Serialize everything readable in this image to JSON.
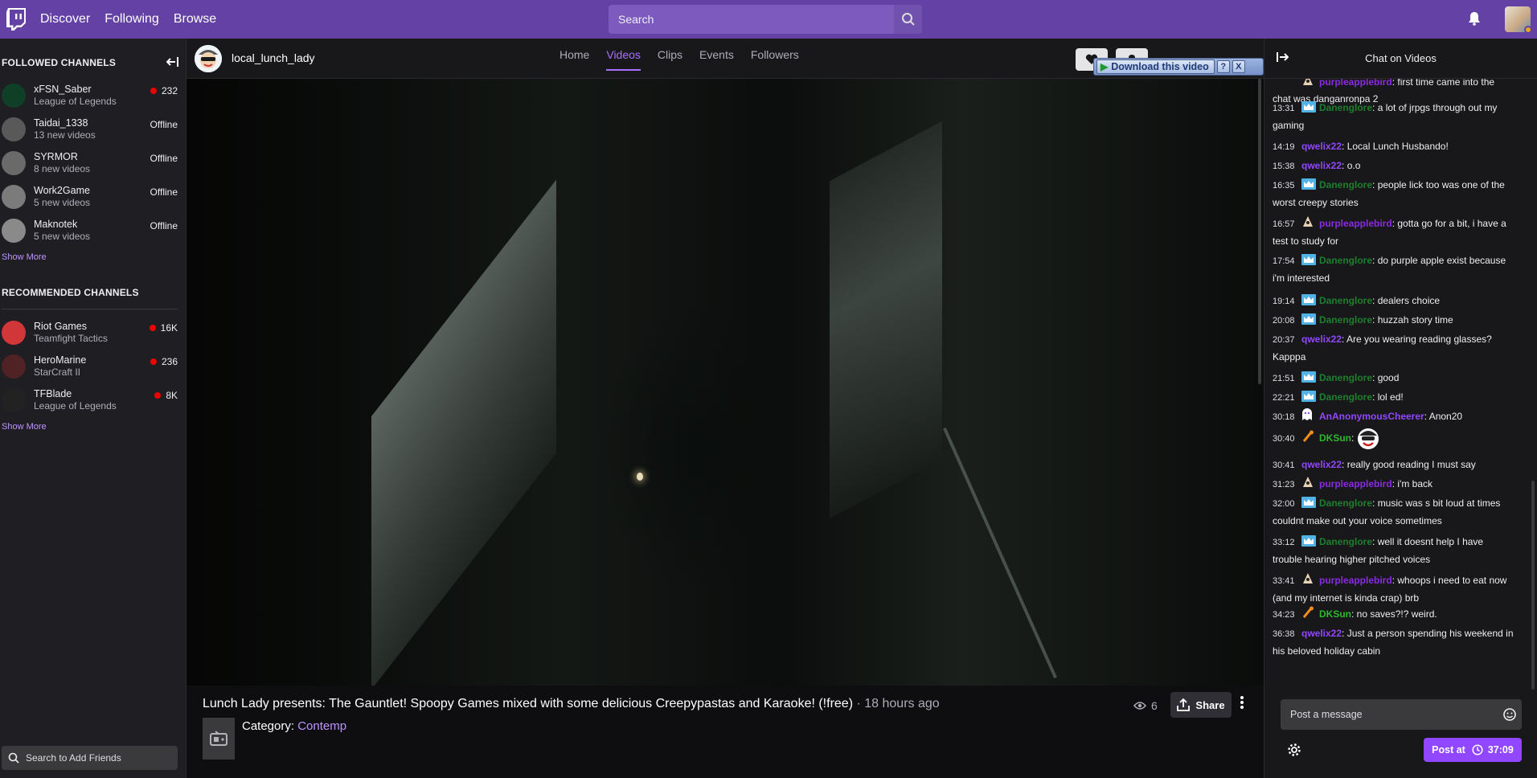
{
  "topnav": {
    "links": [
      "Discover",
      "Following",
      "Browse"
    ],
    "search_placeholder": "Search"
  },
  "sidebar": {
    "followed_header": "FOLLOWED CHANNELS",
    "followed": [
      {
        "name": "xFSN_Saber",
        "sub": "League of Legends",
        "status": "232",
        "live": true,
        "color": "#0f3f26"
      },
      {
        "name": "Taidai_1338",
        "sub": "13 new videos",
        "status": "Offline",
        "live": false,
        "color": "#595959"
      },
      {
        "name": "SYRMOR",
        "sub": "8 new videos",
        "status": "Offline",
        "live": false,
        "color": "#6a6a6a"
      },
      {
        "name": "Work2Game",
        "sub": "5 new videos",
        "status": "Offline",
        "live": false,
        "color": "#7b7b7b"
      },
      {
        "name": "Maknotek",
        "sub": "5 new videos",
        "status": "Offline",
        "live": false,
        "color": "#8a8a8a"
      }
    ],
    "show_more": "Show More",
    "recommended_header": "RECOMMENDED CHANNELS",
    "recommended": [
      {
        "name": "Riot Games",
        "sub": "Teamfight Tactics",
        "status": "16K",
        "live": true,
        "color": "#d13639"
      },
      {
        "name": "HeroMarine",
        "sub": "StarCraft II",
        "status": "236",
        "live": true,
        "color": "#502224"
      },
      {
        "name": "TFBlade",
        "sub": "League of Legends",
        "status": "8K",
        "live": true,
        "color": "#222"
      }
    ],
    "friend_search_placeholder": "Search to Add Friends"
  },
  "channel": {
    "name": "local_lunch_lady",
    "tabs": [
      "Home",
      "Videos",
      "Clips",
      "Events",
      "Followers"
    ],
    "active_tab": "Videos",
    "download_label": "Download this video",
    "download_help": "?",
    "download_close": "X"
  },
  "video": {
    "title": "Lunch Lady presents: The Gauntlet! Spoopy Games mixed with some delicious Creepypastas and Karaoke! (!free)",
    "age": " · 18 hours ago",
    "category_label": "Category:",
    "category": "Contemp",
    "views": "6",
    "share_label": "Share"
  },
  "chat": {
    "title": "Chat on Videos",
    "input_placeholder": "Post a message",
    "post_label": "Post at",
    "post_time": "37:09",
    "messages": [
      {
        "ts": "",
        "user": "purpleapplebird",
        "color": "#8a2be2",
        "badge": "bird",
        "text": "first time came into the chat was danganronpa 2",
        "partial": true
      },
      {
        "ts": "13:31",
        "user": "Danenglore",
        "color": "#1e7f2e",
        "badge": "crown",
        "text": "a lot of jrpgs through out my gaming"
      },
      {
        "ts": "14:19",
        "user": "qwelix22",
        "color": "#9146ff",
        "badge": "",
        "text": "Local Lunch Husbando!"
      },
      {
        "ts": "15:38",
        "user": "qwelix22",
        "color": "#9146ff",
        "badge": "",
        "text": "o.o"
      },
      {
        "ts": "16:35",
        "user": "Danenglore",
        "color": "#1e7f2e",
        "badge": "crown",
        "text": "people lick too was one of the worst creepy stories"
      },
      {
        "ts": "16:57",
        "user": "purpleapplebird",
        "color": "#8a2be2",
        "badge": "bird",
        "text": "gotta go for a bit, i have a test to study for"
      },
      {
        "ts": "17:54",
        "user": "Danenglore",
        "color": "#1e7f2e",
        "badge": "crown",
        "text": "do purple apple exist because i'm interested"
      },
      {
        "ts": "19:14",
        "user": "Danenglore",
        "color": "#1e7f2e",
        "badge": "crown",
        "text": "dealers choice"
      },
      {
        "ts": "20:08",
        "user": "Danenglore",
        "color": "#1e7f2e",
        "badge": "crown",
        "text": "huzzah story time"
      },
      {
        "ts": "20:37",
        "user": "qwelix22",
        "color": "#9146ff",
        "badge": "",
        "text": "Are you wearing reading glasses? Kapppa"
      },
      {
        "ts": "21:51",
        "user": "Danenglore",
        "color": "#1e7f2e",
        "badge": "crown",
        "text": "good"
      },
      {
        "ts": "22:21",
        "user": "Danenglore",
        "color": "#1e7f2e",
        "badge": "crown",
        "text": "lol ed!"
      },
      {
        "ts": "30:18",
        "user": "AnAnonymousCheerer",
        "color": "#9146ff",
        "badge": "ghost",
        "text": "Anon20"
      },
      {
        "ts": "30:40",
        "user": "DKSun",
        "color": "#2eb82e",
        "badge": "drum",
        "text": "",
        "emote": true
      },
      {
        "ts": "30:41",
        "user": "qwelix22",
        "color": "#9146ff",
        "badge": "",
        "text": "really good reading I must say"
      },
      {
        "ts": "31:23",
        "user": "purpleapplebird",
        "color": "#8a2be2",
        "badge": "bird",
        "text": "i'm back"
      },
      {
        "ts": "32:00",
        "user": "Danenglore",
        "color": "#1e7f2e",
        "badge": "crown",
        "text": "music was s bit loud at times couldnt make out your voice sometimes"
      },
      {
        "ts": "33:12",
        "user": "Danenglore",
        "color": "#1e7f2e",
        "badge": "crown",
        "text": "well it doesnt help I have trouble hearing higher pitched voices"
      },
      {
        "ts": "33:41",
        "user": "purpleapplebird",
        "color": "#8a2be2",
        "badge": "bird",
        "text": "whoops i need to eat now (and my internet is kinda crap) brb"
      },
      {
        "ts": "34:23",
        "user": "DKSun",
        "color": "#2eb82e",
        "badge": "drum",
        "text": "no saves?!? weird."
      },
      {
        "ts": "36:38",
        "user": "qwelix22",
        "color": "#9146ff",
        "badge": "",
        "text": "Just a person spending his weekend in his beloved holiday cabin"
      }
    ]
  }
}
